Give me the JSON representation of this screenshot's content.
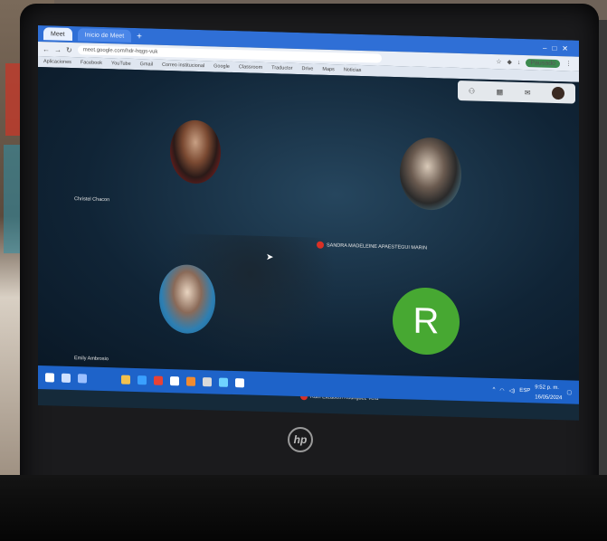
{
  "browser": {
    "tabs": [
      {
        "label": "Meet"
      },
      {
        "label": "Inicio de Meet"
      }
    ],
    "url": "meet.google.com/hdr-hqgs-vuk",
    "bookmarks": [
      "Aplicaciones",
      "Facebook",
      "YouTube",
      "Gmail",
      "Correo institucional",
      "Google",
      "Classroom",
      "Traductor",
      "Drive",
      "Maps",
      "Noticias"
    ],
    "profile_label": "Pausado"
  },
  "meet": {
    "participants": [
      {
        "name": "Christel Chacon",
        "muted": false
      },
      {
        "name": "SANDRA MADELEINE APAESTEGUI MARIN",
        "muted": true
      },
      {
        "name": "Emily Ambrosio",
        "muted": false
      },
      {
        "name": "Ruth Elizabeth Rodriguez Vera",
        "muted": true,
        "initial": "R"
      }
    ]
  },
  "taskbar": {
    "time": "9:52 p. m.",
    "date": "16/05/2024",
    "language": "ESP"
  },
  "device": {
    "brand": "hp"
  },
  "colors": {
    "taskbar": "#1e63c9",
    "avatar_green": "#47a832",
    "mute_red": "#d93025"
  }
}
